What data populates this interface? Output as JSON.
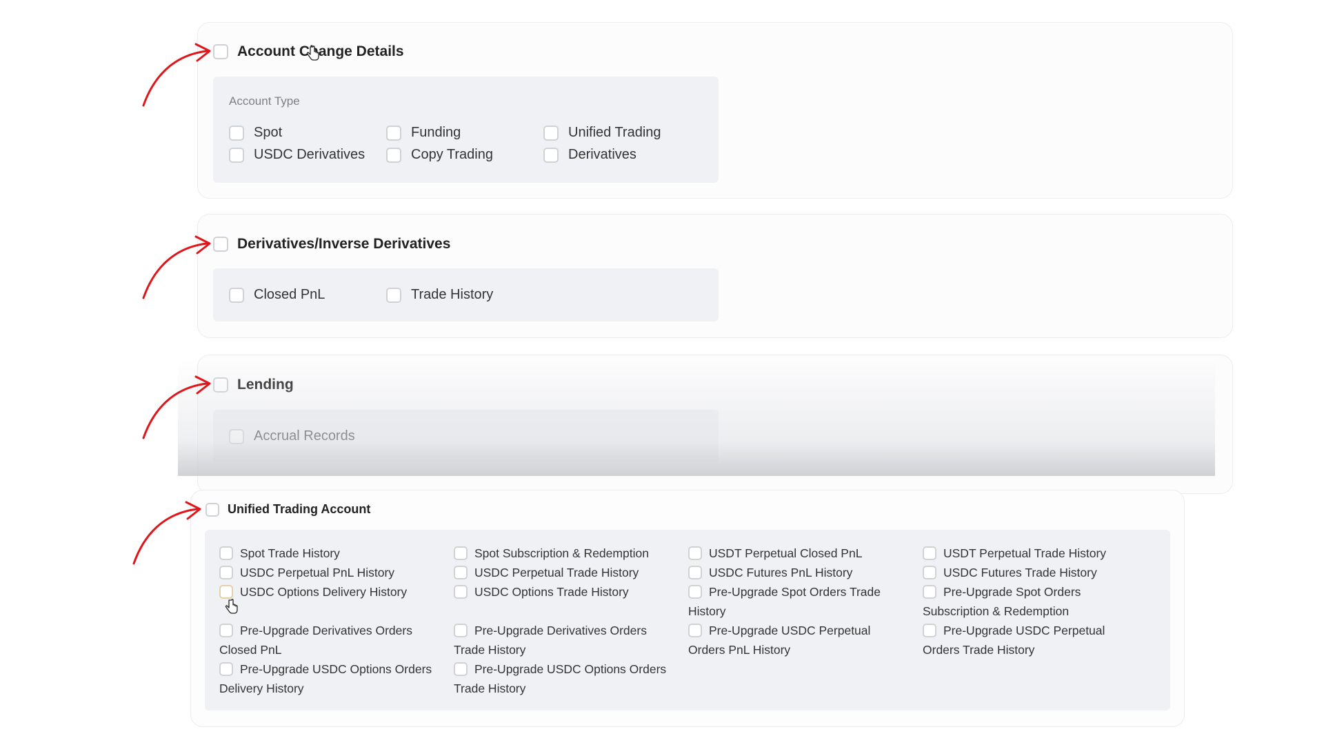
{
  "sections": {
    "account_change": {
      "title": "Account Change Details",
      "subtitle": "Account Type",
      "options": [
        "Spot",
        "Funding",
        "Unified Trading",
        "USDC Derivatives",
        "Copy Trading",
        "Derivatives"
      ]
    },
    "derivatives": {
      "title": "Derivatives/Inverse Derivatives",
      "options": [
        "Closed PnL",
        "Trade History"
      ]
    },
    "lending": {
      "title": "Lending",
      "options": [
        "Accrual Records"
      ]
    },
    "unified": {
      "title": "Unified Trading Account",
      "options": [
        "Spot Trade History",
        "Spot Subscription & Redemption",
        "USDT Perpetual Closed PnL",
        "USDT Perpetual Trade History",
        "USDC Perpetual PnL History",
        "USDC Perpetual Trade History",
        "USDC Futures PnL History",
        "USDC Futures Trade History",
        "USDC Options Delivery History",
        "USDC Options Trade History",
        "Pre-Upgrade Spot Orders Trade History",
        "Pre-Upgrade Spot Orders Subscription & Redemption",
        "Pre-Upgrade Derivatives Orders Closed PnL",
        "Pre-Upgrade Derivatives Orders Trade History",
        "Pre-Upgrade USDC Perpetual Orders PnL History",
        "Pre-Upgrade USDC Perpetual Orders Trade History",
        "Pre-Upgrade USDC Options Orders Delivery History",
        "Pre-Upgrade USDC Options Orders Trade History"
      ]
    }
  },
  "colors": {
    "annotation_arrow": "#e0161b",
    "checkbox_border": "#cfd1d6",
    "group_background": "#f0f1f5"
  },
  "icons": [
    "arrow-annotation-icon",
    "hand-cursor-icon"
  ]
}
